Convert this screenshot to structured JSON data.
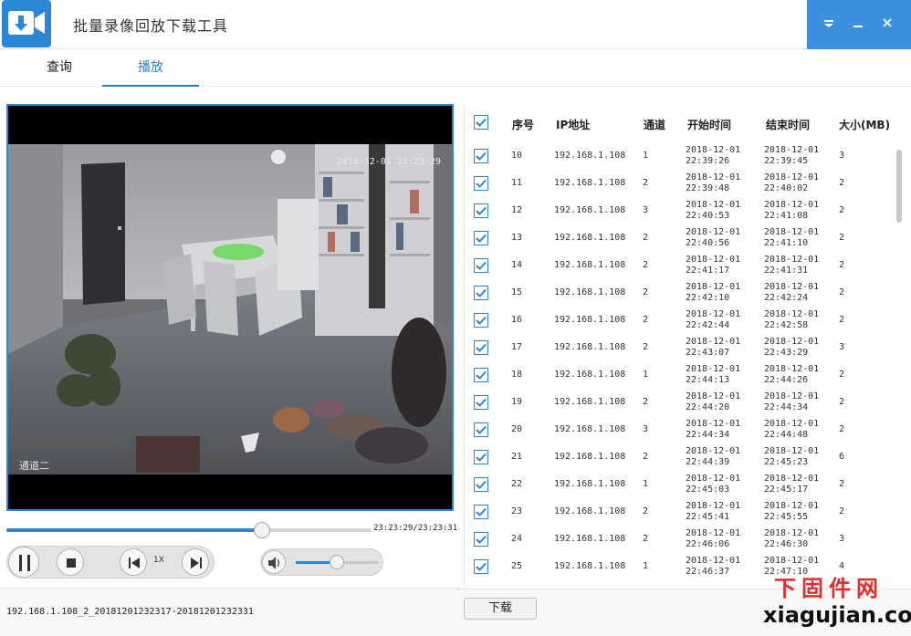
{
  "window": {
    "title": "批量录像回放下载工具",
    "accent": "#3c8fdc",
    "controls": [
      "dropdown",
      "minimize",
      "close"
    ]
  },
  "tabs": [
    {
      "label": "查询",
      "active": false
    },
    {
      "label": "播放",
      "active": true
    }
  ],
  "player": {
    "timestamp": "2018-12-01 23:23:29",
    "channel_label": "通道二",
    "progress_fraction": 0.7,
    "time_readout": "23:23:29/23:23:31",
    "speed": "1X",
    "volume_fraction": 0.49,
    "file_name": "192.168.1.108_2_20181201232317-20181201232331"
  },
  "table": {
    "headers": [
      "序号",
      "IP地址",
      "通道",
      "开始时间",
      "结束时间",
      "大小(MB)"
    ],
    "rows": [
      {
        "no": "10",
        "ip": "192.168.1.108",
        "ch": "1",
        "start_d": "2018-12-01",
        "start_t": "22:39:26",
        "end_d": "2018-12-01",
        "end_t": "22:39:45",
        "size": "3"
      },
      {
        "no": "11",
        "ip": "192.168.1.108",
        "ch": "2",
        "start_d": "2018-12-01",
        "start_t": "22:39:48",
        "end_d": "2018-12-01",
        "end_t": "22:40:02",
        "size": "2"
      },
      {
        "no": "12",
        "ip": "192.168.1.108",
        "ch": "3",
        "start_d": "2018-12-01",
        "start_t": "22:40:53",
        "end_d": "2018-12-01",
        "end_t": "22:41:08",
        "size": "2"
      },
      {
        "no": "13",
        "ip": "192.168.1.108",
        "ch": "2",
        "start_d": "2018-12-01",
        "start_t": "22:40:56",
        "end_d": "2018-12-01",
        "end_t": "22:41:10",
        "size": "2"
      },
      {
        "no": "14",
        "ip": "192.168.1.108",
        "ch": "2",
        "start_d": "2018-12-01",
        "start_t": "22:41:17",
        "end_d": "2018-12-01",
        "end_t": "22:41:31",
        "size": "2"
      },
      {
        "no": "15",
        "ip": "192.168.1.108",
        "ch": "2",
        "start_d": "2018-12-01",
        "start_t": "22:42:10",
        "end_d": "2018-12-01",
        "end_t": "22:42:24",
        "size": "2"
      },
      {
        "no": "16",
        "ip": "192.168.1.108",
        "ch": "2",
        "start_d": "2018-12-01",
        "start_t": "22:42:44",
        "end_d": "2018-12-01",
        "end_t": "22:42:58",
        "size": "2"
      },
      {
        "no": "17",
        "ip": "192.168.1.108",
        "ch": "2",
        "start_d": "2018-12-01",
        "start_t": "22:43:07",
        "end_d": "2018-12-01",
        "end_t": "22:43:29",
        "size": "3"
      },
      {
        "no": "18",
        "ip": "192.168.1.108",
        "ch": "1",
        "start_d": "2018-12-01",
        "start_t": "22:44:13",
        "end_d": "2018-12-01",
        "end_t": "22:44:26",
        "size": "2"
      },
      {
        "no": "19",
        "ip": "192.168.1.108",
        "ch": "2",
        "start_d": "2018-12-01",
        "start_t": "22:44:20",
        "end_d": "2018-12-01",
        "end_t": "22:44:34",
        "size": "2"
      },
      {
        "no": "20",
        "ip": "192.168.1.108",
        "ch": "3",
        "start_d": "2018-12-01",
        "start_t": "22:44:34",
        "end_d": "2018-12-01",
        "end_t": "22:44:48",
        "size": "2"
      },
      {
        "no": "21",
        "ip": "192.168.1.108",
        "ch": "2",
        "start_d": "2018-12-01",
        "start_t": "22:44:39",
        "end_d": "2018-12-01",
        "end_t": "22:45:23",
        "size": "6"
      },
      {
        "no": "22",
        "ip": "192.168.1.108",
        "ch": "1",
        "start_d": "2018-12-01",
        "start_t": "22:45:03",
        "end_d": "2018-12-01",
        "end_t": "22:45:17",
        "size": "2"
      },
      {
        "no": "23",
        "ip": "192.168.1.108",
        "ch": "2",
        "start_d": "2018-12-01",
        "start_t": "22:45:41",
        "end_d": "2018-12-01",
        "end_t": "22:45:55",
        "size": "2"
      },
      {
        "no": "24",
        "ip": "192.168.1.108",
        "ch": "2",
        "start_d": "2018-12-01",
        "start_t": "22:46:06",
        "end_d": "2018-12-01",
        "end_t": "22:46:30",
        "size": "3"
      },
      {
        "no": "25",
        "ip": "192.168.1.108",
        "ch": "1",
        "start_d": "2018-12-01",
        "start_t": "22:46:37",
        "end_d": "2018-12-01",
        "end_t": "22:47:10",
        "size": "4"
      }
    ]
  },
  "download": {
    "label": "下载"
  },
  "watermark": {
    "line1": "下固件网",
    "line2": "xiagujian.com"
  }
}
